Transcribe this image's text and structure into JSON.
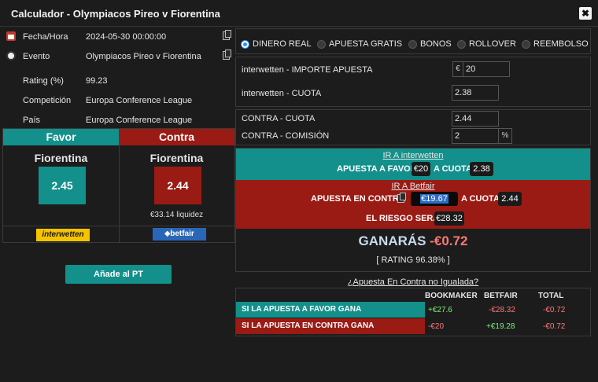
{
  "window": {
    "title": "Calculador - Olympiacos Pireo v Fiorentina",
    "close": "✖"
  },
  "info": {
    "fecha_label": "Fecha/Hora",
    "fecha_value": "2024-05-30 00:00:00",
    "evento_label": "Evento",
    "evento_value": "Olympiacos Pireo v Fiorentina",
    "rating_label": "Rating (%)",
    "rating_value": "99.23",
    "competicion_label": "Competición",
    "competicion_value": "Europa Conference League",
    "pais_label": "País",
    "pais_value": "Europa Conference League"
  },
  "favor": {
    "header": "Favor",
    "team": "Fiorentina",
    "odds": "2.45",
    "bookmaker_logo": "interwetten"
  },
  "contra": {
    "header": "Contra",
    "team": "Fiorentina",
    "odds": "2.44",
    "liquidity": "€33.14 liquidez",
    "exchange_logo": "betfair"
  },
  "add_button": "Añade al PT",
  "modes": [
    {
      "label": "DINERO REAL",
      "selected": true
    },
    {
      "label": "APUESTA GRATIS",
      "selected": false
    },
    {
      "label": "BONOS",
      "selected": false
    },
    {
      "label": "ROLLOVER",
      "selected": false
    },
    {
      "label": "REEMBOLSO",
      "selected": false
    }
  ],
  "stake": {
    "importe_label": "interwetten - IMPORTE APUESTA",
    "currency": "€",
    "importe_value": "20",
    "cuota_label": "interwetten - CUOTA",
    "cuota_value": "2.38"
  },
  "lay": {
    "cuota_label": "CONTRA - CUOTA",
    "cuota_value": "2.44",
    "comision_label": "CONTRA - COMISIÓN",
    "comision_value": "2",
    "comision_unit": "%"
  },
  "summary": {
    "ir_bookmaker": "IR A interwetten",
    "apuesta_favor_label": "APUESTA A FAVOR",
    "apuesta_favor_value": "€20",
    "a_cuota_label": "A CUOTA",
    "favor_cuota": "2.38",
    "ir_exchange": "IR A Betfair",
    "apuesta_contra_label": "APUESTA EN CONTRA",
    "apuesta_contra_value": "€19.67",
    "contra_cuota": "2.44",
    "riesgo_label": "EL RIESGO SERÁ",
    "riesgo_value": "€28.32",
    "ganaras_label": "GANARÁS",
    "ganaras_value": "-€0.72",
    "rating": "[ RATING 96.38% ]"
  },
  "unmatched_link": "¿Apuesta En Contra no Igualada?",
  "outcomes": {
    "headers": [
      "BOOKMAKER",
      "BETFAIR",
      "TOTAL"
    ],
    "rows": [
      {
        "label": "SI LA APUESTA A FAVOR GANA",
        "bookmaker": "+€27.6",
        "betfair": "-€28.32",
        "total": "-€0.72"
      },
      {
        "label": "SI LA APUESTA EN CONTRA GANA",
        "bookmaker": "-€20",
        "betfair": "+€19.28",
        "total": "-€0.72"
      }
    ]
  },
  "colors": {
    "teal": "#13908b",
    "red": "#9a1b14",
    "bg": "#1c1c1c"
  }
}
